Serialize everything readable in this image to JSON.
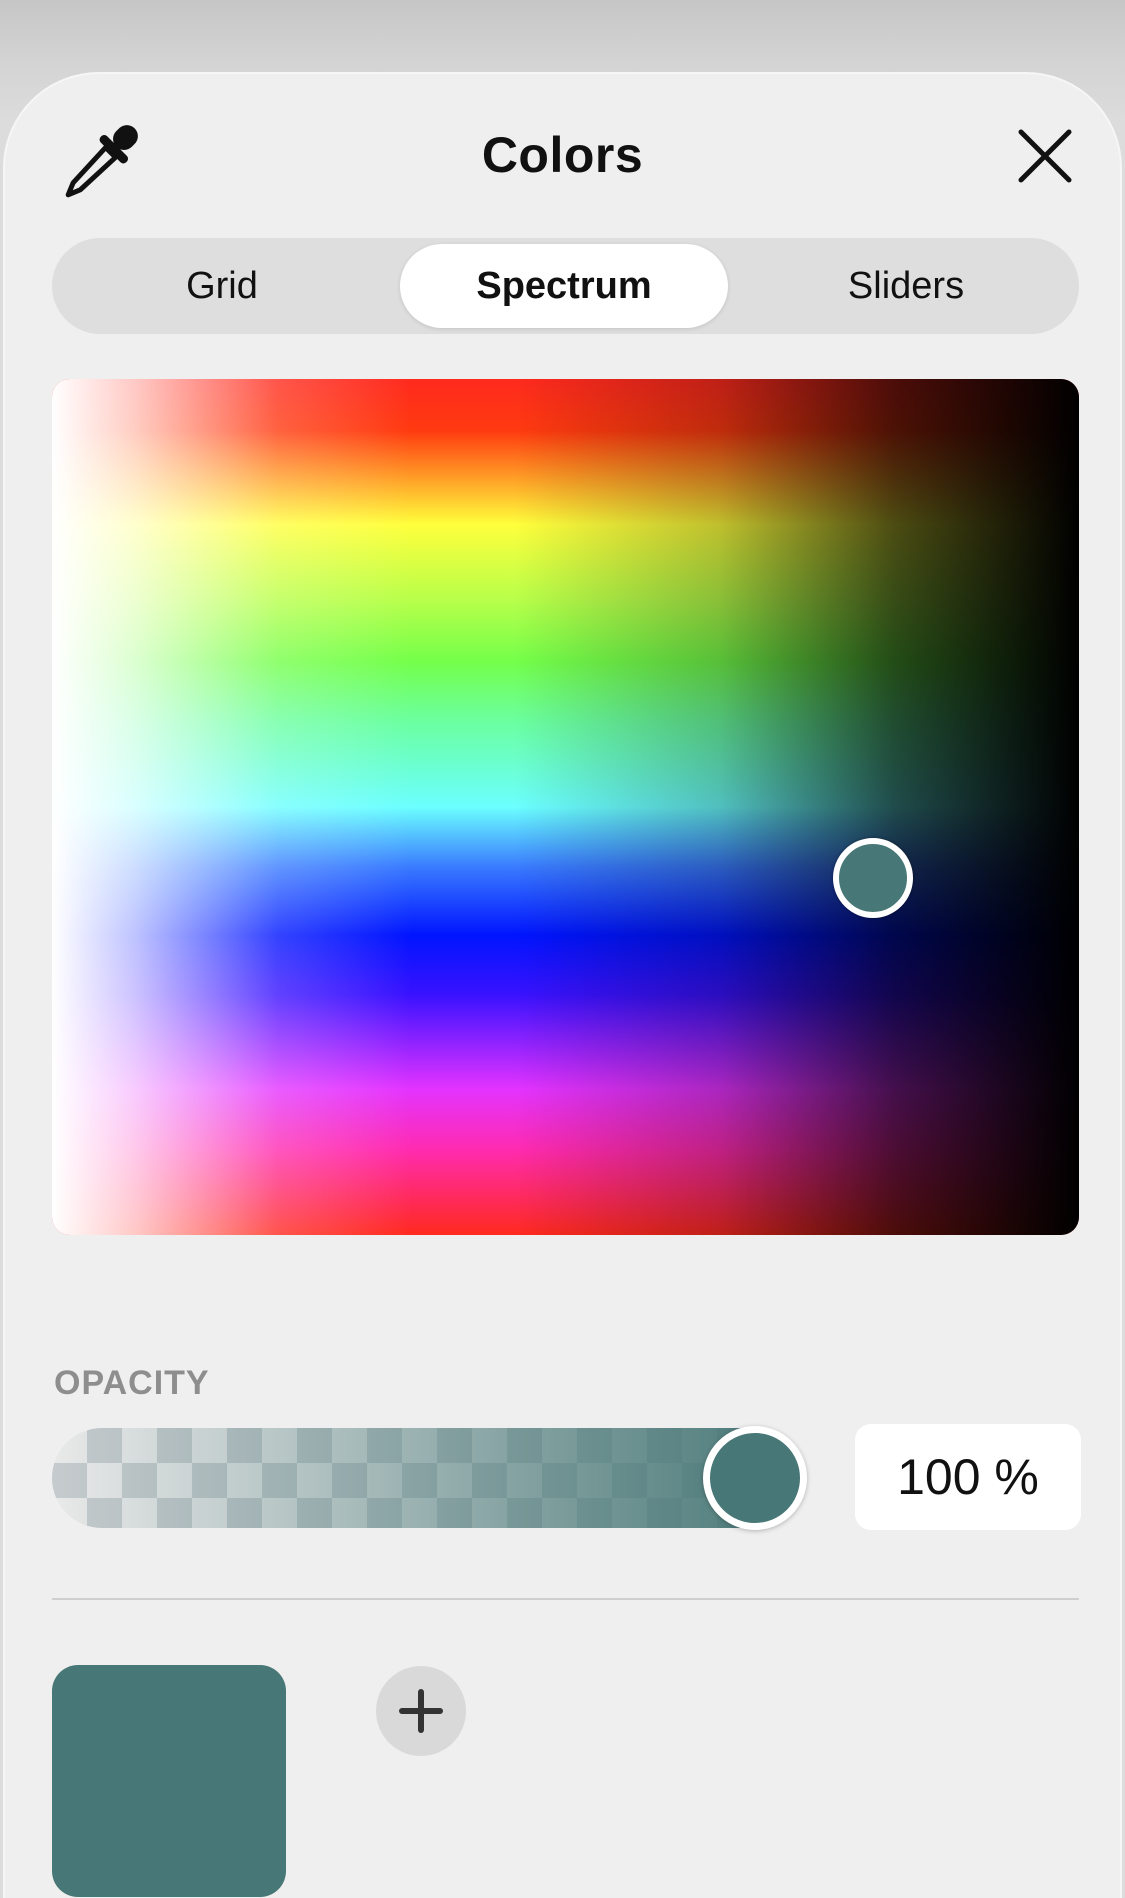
{
  "header": {
    "title": "Colors",
    "eyedropper_icon": "eyedropper-icon",
    "close_icon": "close-icon"
  },
  "tabs": [
    {
      "label": "Grid",
      "active": false
    },
    {
      "label": "Spectrum",
      "active": true
    },
    {
      "label": "Sliders",
      "active": false
    }
  ],
  "opacity": {
    "label": "OPACITY",
    "value_text": "100 %",
    "value": 1.0
  },
  "selected_color": "#477776",
  "add_button_icon": "plus-icon"
}
